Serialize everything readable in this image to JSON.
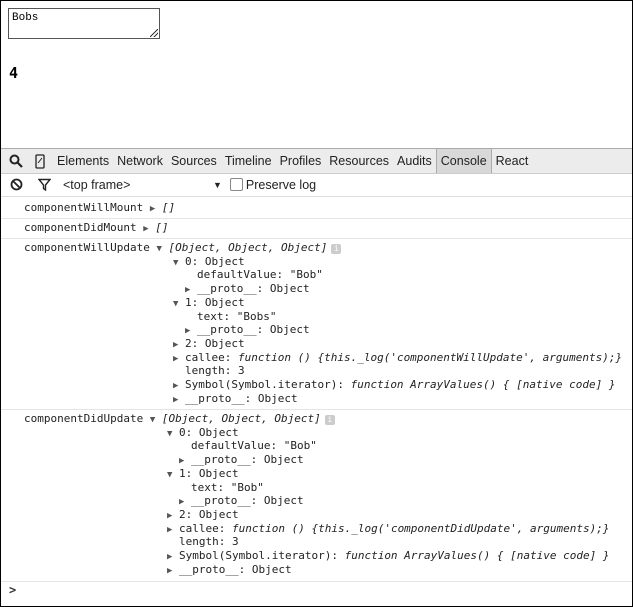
{
  "page": {
    "textarea_value": "Bobs",
    "count": "4"
  },
  "devtools": {
    "tabs": [
      "Elements",
      "Network",
      "Sources",
      "Timeline",
      "Profiles",
      "Resources",
      "Audits",
      "Console",
      "React"
    ],
    "active_tab": "Console",
    "frame_select": "<top frame>",
    "preserve_log": {
      "label": "Preserve log",
      "checked": false
    },
    "prompt": ">"
  },
  "console": [
    {
      "label": "componentWillMount",
      "summary": "[]",
      "expanded": false
    },
    {
      "label": "componentDidMount",
      "summary": "[]",
      "expanded": false
    },
    {
      "label": "componentWillUpdate",
      "summary": "[Object, Object, Object]",
      "expanded": true,
      "info": "i",
      "children": [
        {
          "text": "0: Object",
          "arrow": "down",
          "children": [
            {
              "key": "defaultValue",
              "value": "\"Bob\""
            },
            {
              "key": "__proto__",
              "value": "Object",
              "arrow": "right"
            }
          ]
        },
        {
          "text": "1: Object",
          "arrow": "down",
          "children": [
            {
              "key": "text",
              "value": "\"Bobs\""
            },
            {
              "key": "__proto__",
              "value": "Object",
              "arrow": "right"
            }
          ]
        },
        {
          "text": "2: Object",
          "arrow": "right"
        },
        {
          "key": "callee",
          "value": "function () {this._log('componentWillUpdate', arguments);}",
          "italic": true,
          "arrow": "right"
        },
        {
          "key": "length",
          "value": "3"
        },
        {
          "key": "Symbol(Symbol.iterator)",
          "value": "function ArrayValues() { [native code] }",
          "italic": true,
          "arrow": "right"
        },
        {
          "key": "__proto__",
          "value": "Object",
          "arrow": "right"
        }
      ]
    },
    {
      "label": "componentDidUpdate",
      "summary": "[Object, Object, Object]",
      "expanded": true,
      "info": "i",
      "children": [
        {
          "text": "0: Object",
          "arrow": "down",
          "children": [
            {
              "key": "defaultValue",
              "value": "\"Bob\""
            },
            {
              "key": "__proto__",
              "value": "Object",
              "arrow": "right"
            }
          ]
        },
        {
          "text": "1: Object",
          "arrow": "down",
          "children": [
            {
              "key": "text",
              "value": "\"Bob\""
            },
            {
              "key": "__proto__",
              "value": "Object",
              "arrow": "right"
            }
          ]
        },
        {
          "text": "2: Object",
          "arrow": "right"
        },
        {
          "key": "callee",
          "value": "function () {this._log('componentDidUpdate', arguments);}",
          "italic": true,
          "arrow": "right"
        },
        {
          "key": "length",
          "value": "3"
        },
        {
          "key": "Symbol(Symbol.iterator)",
          "value": "function ArrayValues() { [native code] }",
          "italic": true,
          "arrow": "right"
        },
        {
          "key": "__proto__",
          "value": "Object",
          "arrow": "right"
        }
      ]
    }
  ]
}
